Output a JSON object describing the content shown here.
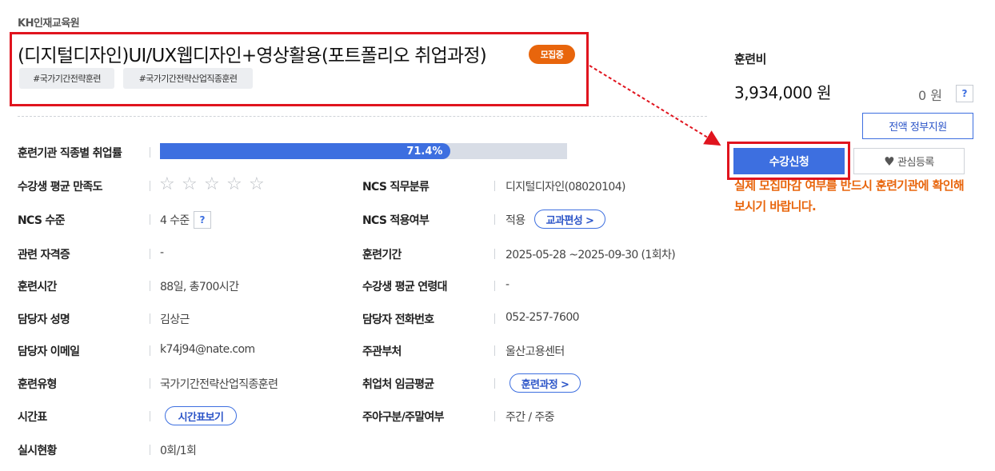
{
  "header": {
    "institution": "KH인재교육원",
    "title": "(디지털디자인)UI/UX웹디자인+영상활용(포트폴리오 취업과정)",
    "status_badge": "모집중",
    "tags": [
      "#국가기간전략훈련",
      "#국가기간전략산업직종훈련"
    ]
  },
  "info": {
    "employment_rate": {
      "label": "훈련기관 직종별 취업률",
      "value": "71.4%",
      "percent": 71.4
    },
    "satisfaction": {
      "label": "수강생 평균 만족도",
      "stars_filled": 0,
      "stars_total": 5
    },
    "ncs_level": {
      "label": "NCS 수준",
      "value": "4 수준",
      "help": "?"
    },
    "certification": {
      "label": "관련 자격증",
      "value": "-"
    },
    "training_hours": {
      "label": "훈련시간",
      "value": "88일, 총700시간"
    },
    "manager_name": {
      "label": "담당자 성명",
      "value": "김상근"
    },
    "manager_email": {
      "label": "담당자 이메일",
      "value": "k74j94@nate.com"
    },
    "training_type": {
      "label": "훈련유형",
      "value": "국가기간전략산업직종훈련"
    },
    "timetable": {
      "label": "시간표",
      "button": "시간표보기"
    },
    "status": {
      "label": "실시현황",
      "value": "0회/1회"
    },
    "ncs_category": {
      "label": "NCS 직무분류",
      "value": "디지털디자인(08020104)"
    },
    "ncs_applied": {
      "label": "NCS 적용여부",
      "value": "적용",
      "button": "교과편성 >"
    },
    "training_period": {
      "label": "훈련기간",
      "value": "2025-05-28 ~2025-09-30 (1회차)"
    },
    "avg_age": {
      "label": "수강생 평균 연령대",
      "value": "-"
    },
    "manager_phone": {
      "label": "담당자 전화번호",
      "value": "052-257-7600"
    },
    "department": {
      "label": "주관부처",
      "value": "울산고용센터"
    },
    "avg_wage": {
      "label": "취업처 임금평균",
      "button": "훈련과정 >"
    },
    "day_type": {
      "label": "주야구분/주말여부",
      "value": "주간 / 주중"
    }
  },
  "side": {
    "fee_label": "훈련비",
    "fee_amount": "3,934,000 원",
    "self_pay": "0 원",
    "help": "?",
    "gov_support_button": "전액 정부지원",
    "enroll_button": "수강신청",
    "wishlist_button": "관심등록",
    "notice": "실제 모집마감 여부를 반드시 훈련기관에 확인해보시기 바랍니다."
  },
  "colors": {
    "accent": "#3d6fe0",
    "badge": "#e8650c",
    "highlight_box": "#e0141e",
    "notice": "#e8650c"
  }
}
